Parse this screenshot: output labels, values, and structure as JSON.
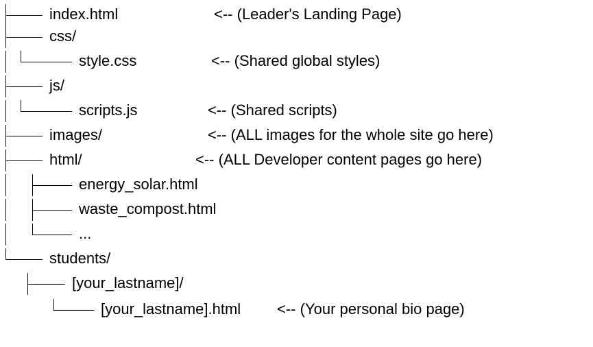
{
  "tree": {
    "rows": [
      {
        "id": "index",
        "name": "index.html",
        "note": "<-- (Leader's Landing Page)"
      },
      {
        "id": "css",
        "name": "css/",
        "note": ""
      },
      {
        "id": "style",
        "name": "style.css",
        "note": "<-- (Shared global styles)"
      },
      {
        "id": "js",
        "name": "js/",
        "note": ""
      },
      {
        "id": "scripts",
        "name": "scripts.js",
        "note": "<-- (Shared scripts)"
      },
      {
        "id": "images",
        "name": "images/",
        "note": "<-- (ALL images for the whole site go here)"
      },
      {
        "id": "html",
        "name": "html/",
        "note": "<-- (ALL Developer content pages go here)"
      },
      {
        "id": "energy",
        "name": "energy_solar.html",
        "note": ""
      },
      {
        "id": "waste",
        "name": "waste_compost.html",
        "note": ""
      },
      {
        "id": "more",
        "name": "...",
        "note": ""
      },
      {
        "id": "students",
        "name": "students/",
        "note": ""
      },
      {
        "id": "lastname-dir",
        "name": "[your_lastname]/",
        "note": ""
      },
      {
        "id": "lastname-file",
        "name": "[your_lastname].html",
        "note": "<-- (Your personal bio page)"
      }
    ]
  }
}
